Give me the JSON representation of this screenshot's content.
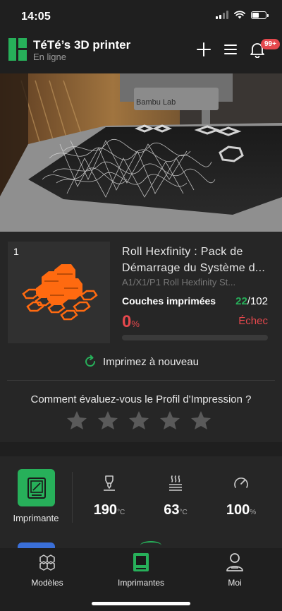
{
  "status_bar": {
    "time": "14:05"
  },
  "header": {
    "title": "TéTé’s 3D printer",
    "status": "En ligne",
    "notification_badge": "99+",
    "icons": [
      "logo-icon",
      "add-icon",
      "menu-icon",
      "bell-icon"
    ]
  },
  "camera": {
    "brand_text": "Bambu Lab"
  },
  "job": {
    "index": "1",
    "title": "Roll Hexfinity : Pack de Démarrage du Système d...",
    "subtitle": "A1/X1/P1 Roll Hexfinity St...",
    "layers_label": "Couches imprimées",
    "layers_current": "22",
    "layers_total": "/102",
    "percent": "0",
    "percent_unit": "%",
    "status": "Échec",
    "progress": 0,
    "reprint_label": "Imprimez à nouveau",
    "rating_question": "Comment évaluez-vous le Profil d'Impression ?",
    "rating_stars": 5,
    "rating_value": 0
  },
  "controls": {
    "printer_label": "Imprimante",
    "nozzle_temp": "190",
    "bed_temp": "63",
    "fan_speed": "100",
    "temp_unit": "°C",
    "percent_unit": "%"
  },
  "tabs": [
    {
      "label": "Modèles",
      "icon": "models-icon",
      "active": false
    },
    {
      "label": "Imprimantes",
      "icon": "printer-icon",
      "active": true
    },
    {
      "label": "Moi",
      "icon": "profile-icon",
      "active": false
    }
  ],
  "colors": {
    "accent_green": "#27b05a",
    "error_red": "#e5484d",
    "background": "#1f1f1f",
    "card": "#262626"
  }
}
